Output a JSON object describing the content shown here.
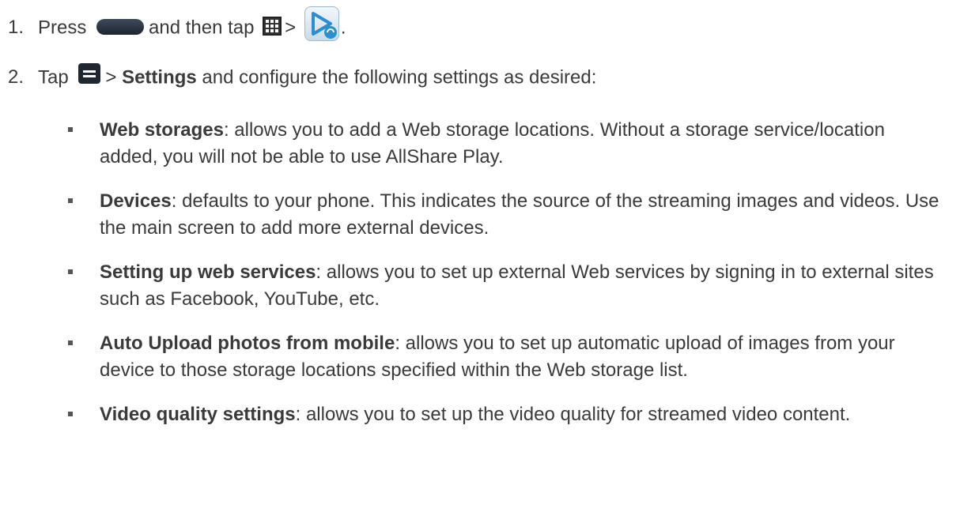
{
  "steps": [
    {
      "number": "1.",
      "text_a": "Press",
      "text_b": "and then tap",
      "text_c": ">",
      "text_d": ".",
      "icons": [
        "home-key-icon",
        "apps-grid-icon",
        "allshare-play-app-icon"
      ]
    },
    {
      "number": "2.",
      "text_a": "Tap",
      "text_b": ">",
      "bold": "Settings",
      "text_c": "and configure the following settings as desired:",
      "icons": [
        "menu-key-icon"
      ]
    }
  ],
  "settings": [
    {
      "term": "Web storages",
      "description": ": allows you to add a Web storage locations. Without a storage service/location added, you will not be able to use AllShare Play."
    },
    {
      "term": "Devices",
      "description": ": defaults to your phone. This indicates the source of the streaming images and videos. Use the main screen to add more external devices."
    },
    {
      "term": "Setting up web services",
      "description": ": allows you to set up external Web services by signing in to external sites such as Facebook, YouTube, etc."
    },
    {
      "term": "Auto Upload photos from mobile",
      "description": ": allows you to set up automatic upload of images from your device to those storage locations specified within the Web storage list."
    },
    {
      "term": "Video quality settings",
      "description": ": allows you to set up the video quality for streamed video content."
    }
  ],
  "colors": {
    "text": "#3a3a3a",
    "key_dark": "#1d2530",
    "app_icon_blue": "#2a8fd0"
  }
}
